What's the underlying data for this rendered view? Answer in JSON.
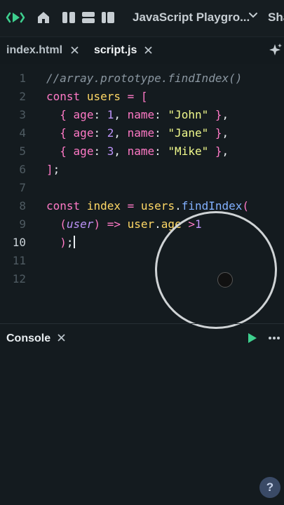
{
  "topbar": {
    "title": "JavaScript Playgro...",
    "share_label": "Sha",
    "icons": [
      "play-logo-icon",
      "home-icon",
      "split-layout-icon",
      "stacked-layout-icon",
      "sidebar-layout-icon",
      "chevron-down-icon"
    ]
  },
  "tabs": [
    {
      "label": "index.html"
    },
    {
      "label": "script.js"
    }
  ],
  "editor": {
    "line_numbers": [
      "1",
      "2",
      "3",
      "4",
      "5",
      "6",
      "7",
      "8",
      "9",
      "10",
      "11",
      "12"
    ],
    "current_line": "10"
  },
  "console": {
    "label": "Console"
  },
  "help_label": "?",
  "colors": {
    "background": "#141b1f",
    "keyword": "#ff79c6",
    "string": "#f1fa8c",
    "number": "#bd93f9",
    "function": "#82b1ff",
    "variable": "#ffd866",
    "accent_green": "#3ecf8e"
  }
}
